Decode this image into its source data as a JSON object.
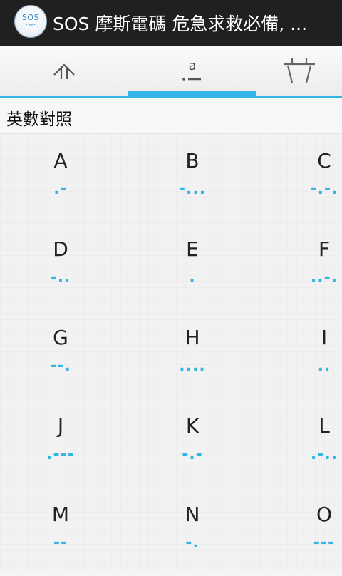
{
  "titlebar": {
    "logo_text": "SOS",
    "logo_morse": "·−·",
    "title": "SOS 摩斯電碼 危急求救必備, ..."
  },
  "tabs": [
    {
      "name": "home",
      "icon": "chevron-up-icon",
      "selected": false
    },
    {
      "name": "alphabet",
      "icon": "alphabet-morse-icon",
      "label": "a",
      "selected": true
    },
    {
      "name": "basket",
      "icon": "basket-icon",
      "selected": false
    }
  ],
  "colors": {
    "accent": "#33b5e5",
    "titlebar_bg": "#202020"
  },
  "section": {
    "title": "英數對照"
  },
  "morse_table": [
    {
      "letter": "A",
      "code": ".-"
    },
    {
      "letter": "B",
      "code": "-..."
    },
    {
      "letter": "C",
      "code": "-.-."
    },
    {
      "letter": "D",
      "code": "-.."
    },
    {
      "letter": "E",
      "code": "."
    },
    {
      "letter": "F",
      "code": "..-."
    },
    {
      "letter": "G",
      "code": "--."
    },
    {
      "letter": "H",
      "code": "...."
    },
    {
      "letter": "I",
      "code": ".."
    },
    {
      "letter": "J",
      "code": ".---"
    },
    {
      "letter": "K",
      "code": "-.-"
    },
    {
      "letter": "L",
      "code": ".-.."
    },
    {
      "letter": "M",
      "code": "--"
    },
    {
      "letter": "N",
      "code": "-."
    },
    {
      "letter": "O",
      "code": "---"
    }
  ]
}
